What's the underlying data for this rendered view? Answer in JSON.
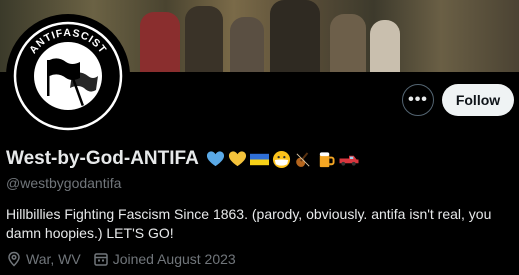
{
  "profile": {
    "display_name": "West-by-God-ANTIFA",
    "handle": "@westbygodantifa",
    "bio": "Hillbillies Fighting Fascism Since 1863. (parody, obviously. antifa isn't real, you damn hoopies.) LET'S GO!",
    "location": "War, WV",
    "joined": "Joined August 2023",
    "avatar_text_top": "ANTIFASCIST",
    "avatar_text_bottom": "ACTION",
    "name_emojis": [
      "blue-heart-icon",
      "yellow-heart-icon",
      "ukraine-flag-icon",
      "mask-face-icon",
      "violin-icon",
      "beer-mug-icon",
      "pickup-truck-icon"
    ]
  },
  "actions": {
    "more_label": "•••",
    "follow_label": "Follow"
  },
  "colors": {
    "background": "#000000",
    "text_primary": "#e7e9ea",
    "text_secondary": "#71767b",
    "follow_bg": "#eff3f4",
    "heart_blue": "#5aa9e6",
    "heart_yellow": "#f5c33b"
  }
}
